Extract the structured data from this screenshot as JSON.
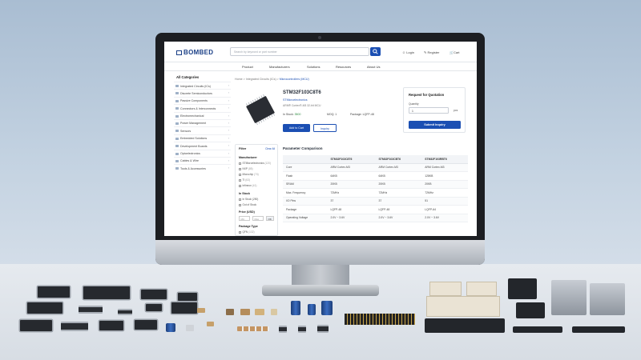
{
  "brand": {
    "logo_text": "BOMBED"
  },
  "header": {
    "search_placeholder": "Search by keyword or part number",
    "login": "Login",
    "register": "Register",
    "cart": "Cart"
  },
  "nav": {
    "items": [
      "Product",
      "Manufacturers",
      "Solutions",
      "Resources",
      "About Us"
    ]
  },
  "sidebar": {
    "title": "All Categories",
    "items": [
      "Integrated Circuits (ICs)",
      "Discrete Semiconductors",
      "Passive Components",
      "Connectors & Interconnects",
      "Electromechanical",
      "Power Management",
      "Sensors",
      "Embedded Solutions",
      "Development Boards",
      "Optoelectronics",
      "Cables & Wire",
      "Tools & Accessories"
    ]
  },
  "breadcrumb": [
    "Home",
    "Integrated Circuits (ICs)",
    "Microcontrollers (MCU)"
  ],
  "product": {
    "name": "STM32F103C8T6",
    "manufacturer": "STMicroelectronics",
    "description": "ARM® Cortex®-M3 32-bit MCU",
    "stock_label": "In Stock:",
    "stock_value": "3500",
    "moq": "MOQ: 1",
    "package": "Package: LQFP-48",
    "add_to_cart": "Add to Cart",
    "inquiry": "Inquiry"
  },
  "rfq": {
    "title": "Request for Quotation",
    "qty_label": "Quantity",
    "qty_value": "1",
    "unit": "pcs",
    "submit": "Submit Inquiry"
  },
  "filter": {
    "title": "Filter",
    "clear": "Clear All",
    "manufacturer_title": "Manufacturer",
    "manufacturers": [
      {
        "name": "STMicroelectronics",
        "count": "(120)"
      },
      {
        "name": "NXP",
        "count": "(85)"
      },
      {
        "name": "Microchip",
        "count": "(74)"
      },
      {
        "name": "TI",
        "count": "(63)"
      },
      {
        "name": "Infineon",
        "count": "(41)"
      }
    ],
    "stock_title": "In Stock",
    "stock_options": [
      "In Stock (250)",
      "Out of Stock"
    ],
    "price_title": "Price (USD)",
    "price_min": "Min",
    "price_max": "Max",
    "price_go": "OK",
    "package_title": "Package Type",
    "package_options": [
      {
        "name": "QFN",
        "count": "(132)"
      }
    ]
  },
  "comparison": {
    "title": "Parameter Comparison",
    "columns": [
      "",
      "STM32F103C8T6",
      "STM32F103CBT6",
      "STM32F103RBT6"
    ],
    "rows": [
      [
        "Core",
        "ARM Cortex-M3",
        "ARM Cortex-M3",
        "ARM Cortex-M3"
      ],
      [
        "Flash",
        "64KB",
        "64KB",
        "128KB"
      ],
      [
        "SRAM",
        "20KB",
        "20KB",
        "20KB"
      ],
      [
        "Max. Frequency",
        "72MHz",
        "72MHz",
        "72MHz"
      ],
      [
        "I/O Pins",
        "37",
        "37",
        "51"
      ],
      [
        "Package",
        "LQFP-48",
        "LQFP-48",
        "LQFP-64"
      ],
      [
        "Operating Voltage",
        "2.0V ~ 3.6V",
        "2.0V ~ 3.6V",
        "2.0V ~ 3.6V"
      ]
    ]
  },
  "colors": {
    "accent": "#1b4fb3",
    "brand": "#1a3f86"
  }
}
